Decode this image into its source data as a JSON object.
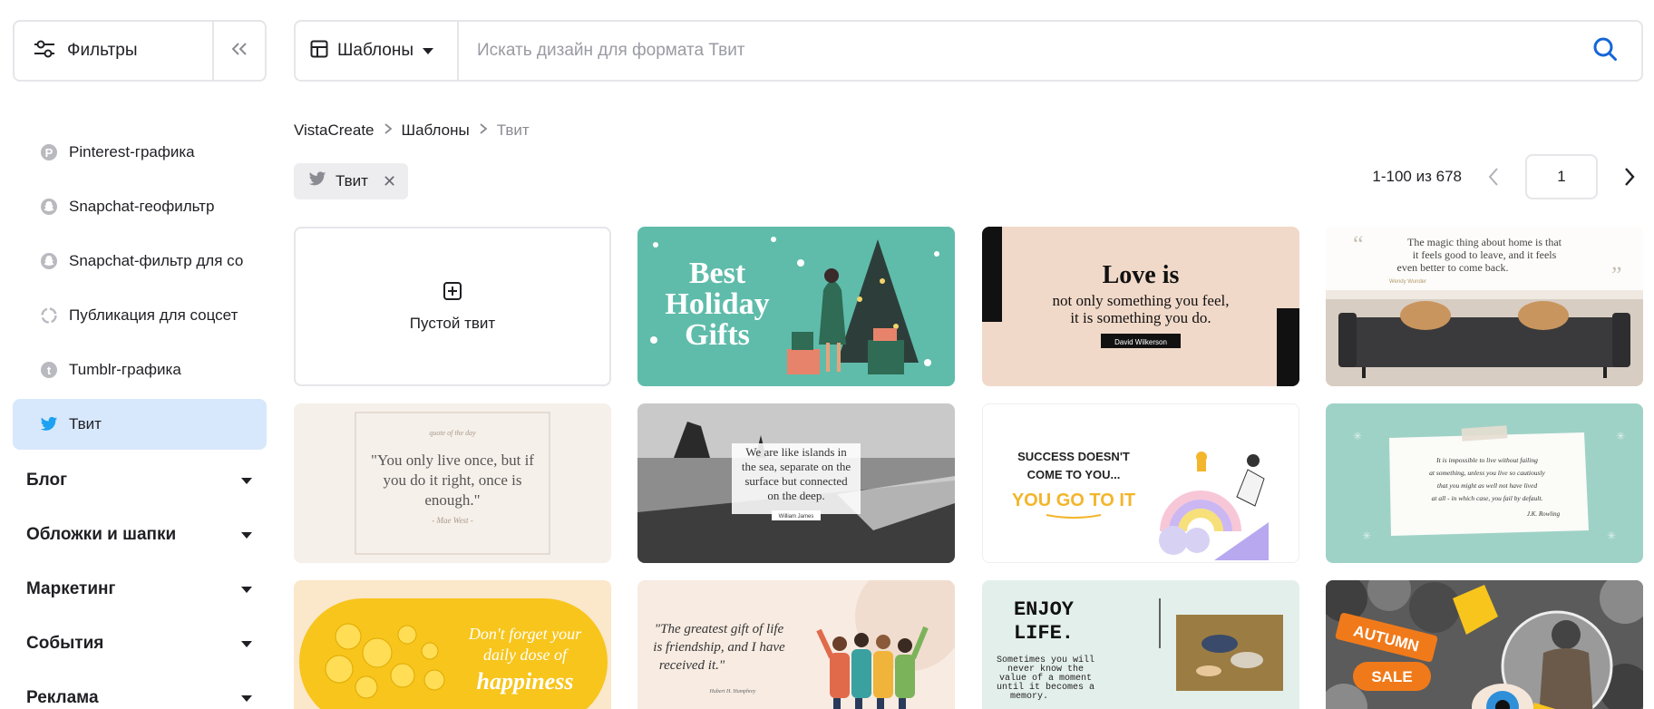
{
  "filters": {
    "label": "Фильтры"
  },
  "search": {
    "type_label": "Шаблоны",
    "placeholder": "Искать дизайн для формата Твит"
  },
  "sidebar": {
    "items": [
      {
        "label": "Pinterest-графика",
        "icon": "pinterest-icon"
      },
      {
        "label": "Snapchat-геофильтр",
        "icon": "snapchat-icon"
      },
      {
        "label": "Snapchat-фильтр для со",
        "icon": "snapchat-icon"
      },
      {
        "label": "Публикация для соцсет",
        "icon": "share-loop-icon"
      },
      {
        "label": "Tumblr-графика",
        "icon": "tumblr-icon"
      },
      {
        "label": "Твит",
        "icon": "twitter-icon",
        "active": true
      }
    ],
    "categories": [
      "Блог",
      "Обложки и шапки",
      "Маркетинг",
      "События",
      "Реклама"
    ]
  },
  "breadcrumb": [
    "VistaCreate",
    "Шаблоны",
    "Твит"
  ],
  "chip": {
    "label": "Твит"
  },
  "pagination": {
    "count": "1-100 из 678",
    "page": "1"
  },
  "blank_card": {
    "label": "Пустой твит"
  },
  "templates": {
    "holiday": {
      "line1": "Best",
      "line2": "Holiday",
      "line3": "Gifts"
    },
    "love": {
      "title": "Love is",
      "line1": "not only something you feel,",
      "line2": "it is something you do.",
      "author": "David Wilkerson"
    },
    "home": {
      "line1": "The magic thing about home is that",
      "line2": "it feels good to leave, and it feels",
      "line3": "even better to come back.",
      "author": "Wendy Wunder"
    },
    "yolo": {
      "kicker": "quote of the day",
      "line1": "\"You only live once, but if",
      "line2": "you do it right, once is",
      "line3": "enough.\"",
      "author": "- Mae West -"
    },
    "islands": {
      "line1": "We are like islands in",
      "line2": "the sea, separate on the",
      "line3": "surface but connected",
      "line4": "on the deep.",
      "author": "William James"
    },
    "success": {
      "line1": "SUCCESS DOESN'T",
      "line2": "COME TO YOU...",
      "line3": "YOU GO TO IT"
    },
    "rowling": {
      "line1": "It is impossible to live without failing",
      "line2": "at something, unless you live so cautiously",
      "line3": "that you might as well not have lived",
      "line4": "at all - in which case, you fail by default.",
      "author": "J.K. Rowling"
    },
    "happiness": {
      "line1": "Don't forget your",
      "line2": "daily dose of",
      "line3": "happiness"
    },
    "friendship": {
      "line1": "\"The greatest gift of life",
      "line2": "is friendship, and I have",
      "line3": "received it.\"",
      "author": "Hubert H. Humphrey"
    },
    "enjoy": {
      "title1": "ENJOY",
      "title2": "LIFE.",
      "line1": "Sometimes you will",
      "line2": "never know the",
      "line3": "value of a moment",
      "line4": "until it becomes a",
      "line5": "memory."
    },
    "autumn": {
      "line1": "AUTUMN",
      "line2": "SALE"
    }
  },
  "colors": {
    "accent_blue": "#1565d8",
    "active_bg": "#d7e8fc",
    "border": "#e6e6ea"
  }
}
